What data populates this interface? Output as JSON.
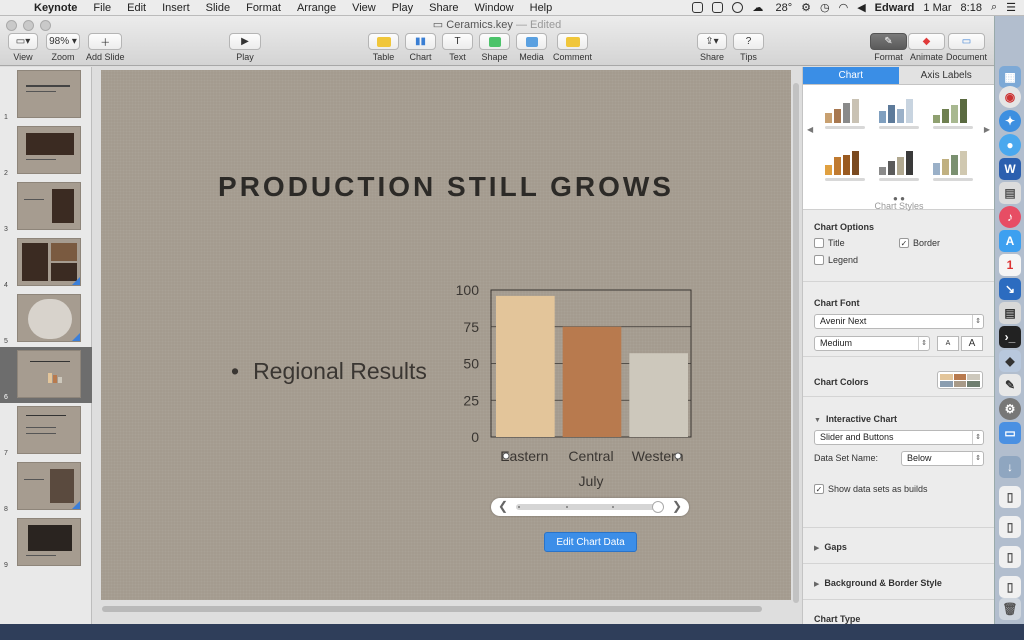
{
  "menubar": {
    "app": "Keynote",
    "items": [
      "File",
      "Edit",
      "Insert",
      "Slide",
      "Format",
      "Arrange",
      "View",
      "Play",
      "Share",
      "Window",
      "Help"
    ],
    "temperature": "28°",
    "user": "Edward",
    "date": "1 Mar",
    "time": "8:18"
  },
  "window": {
    "doc_name": "Ceramics.key",
    "doc_status": "— Edited"
  },
  "toolbar": {
    "view": "View",
    "zoom_value": "98%",
    "zoom": "Zoom",
    "add_slide": "Add Slide",
    "play": "Play",
    "table": "Table",
    "chart": "Chart",
    "text": "Text",
    "shape": "Shape",
    "media": "Media",
    "comment": "Comment",
    "share": "Share",
    "tips": "Tips",
    "format": "Format",
    "animate": "Animate",
    "document": "Document"
  },
  "navigator": {
    "slides": [
      "1",
      "2",
      "3",
      "4",
      "5",
      "6",
      "7",
      "8",
      "9"
    ],
    "selected": "6"
  },
  "slide": {
    "title": "PRODUCTION STILL GROWS",
    "bullet": "Regional Results",
    "edit_chart_data": "Edit Chart Data"
  },
  "chart_data": {
    "type": "bar",
    "categories": [
      "Eastern",
      "Central",
      "Western"
    ],
    "values": [
      96,
      75,
      57
    ],
    "ylim": [
      0,
      100
    ],
    "yticks": [
      "0",
      "25",
      "50",
      "75",
      "100"
    ],
    "dataset_label": "July",
    "colors": [
      "#e3c59a",
      "#b87a4e",
      "#cdc8bc"
    ],
    "grid": true,
    "legend": "none"
  },
  "inspector": {
    "tab_chart": "Chart",
    "tab_axis": "Axis Labels",
    "chart_styles": "Chart Styles",
    "chart_options": "Chart Options",
    "title": "Title",
    "border": "Border",
    "legend": "Legend",
    "chart_font": "Chart Font",
    "font_name": "Avenir Next",
    "font_weight": "Medium",
    "size_small": "A",
    "size_large": "A",
    "chart_colors": "Chart Colors",
    "interactive_chart": "Interactive Chart",
    "interactive_mode": "Slider and Buttons",
    "data_set_name": "Data Set Name:",
    "data_set_position": "Below",
    "show_data_sets": "Show data sets as builds",
    "gaps": "Gaps",
    "background_border": "Background & Border Style",
    "chart_type": "Chart Type"
  }
}
